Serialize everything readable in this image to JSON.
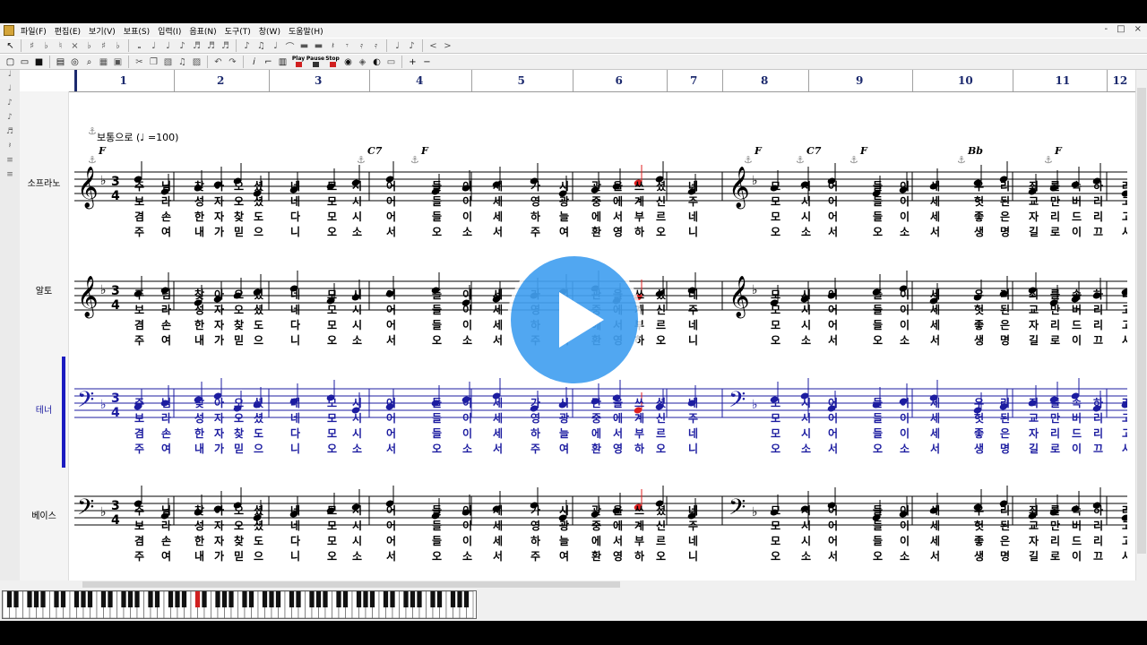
{
  "menu": [
    "파일(F)",
    "편집(E)",
    "보기(V)",
    "보표(S)",
    "입력(I)",
    "음표(N)",
    "도구(T)",
    "창(W)",
    "도움말(H)"
  ],
  "window_controls": [
    "-",
    "□",
    "×"
  ],
  "toolbar2": {
    "play": "Play",
    "pause": "Pause",
    "stop": "Stop"
  },
  "tempo_text": "보통으로 (♩ =100)",
  "measure_numbers": [
    "1",
    "2",
    "3",
    "4",
    "5",
    "6",
    "7",
    "8",
    "9",
    "10",
    "11",
    "12"
  ],
  "parts": [
    {
      "name": "소프라노",
      "clef": "treble",
      "color": "#000000"
    },
    {
      "name": "알토",
      "clef": "treble",
      "color": "#000000"
    },
    {
      "name": "테너",
      "clef": "bass",
      "color": "#1c1ca0"
    },
    {
      "name": "베이스",
      "clef": "bass",
      "color": "#000000"
    }
  ],
  "time_signature": "3/4",
  "key_signature": "F major (1 flat)",
  "chords": [
    {
      "measure": 1,
      "label": "F"
    },
    {
      "measure": 4,
      "label": "C7"
    },
    {
      "measure": 4,
      "label": "F"
    },
    {
      "measure": 8,
      "label": "F"
    },
    {
      "measure": 9,
      "label": "C7"
    },
    {
      "measure": 10,
      "label": "F"
    },
    {
      "measure": 11,
      "label": "Bb"
    },
    {
      "measure": 12,
      "label": "F"
    }
  ],
  "lyrics": [
    [
      "주",
      "님",
      "찾",
      "아",
      "오",
      "셨",
      "네",
      "모",
      "시",
      "어",
      "들",
      "이",
      "세",
      "가",
      "시",
      "관",
      "을",
      "쓰",
      "셨",
      "네",
      "모",
      "시",
      "어",
      "들",
      "이",
      "세",
      "우",
      "리",
      "죄",
      "를",
      "속",
      "하",
      "려"
    ],
    [
      "보",
      "라",
      "성",
      "자",
      "오",
      "셨",
      "네",
      "모",
      "시",
      "어",
      "들",
      "이",
      "세",
      "영",
      "광",
      "중",
      "에",
      "계",
      "신",
      "주",
      "모",
      "시",
      "어",
      "들",
      "이",
      "세",
      "헛",
      "된",
      "교",
      "만",
      "버",
      "리",
      "고"
    ],
    [
      "겸",
      "손",
      "한",
      "자",
      "찾",
      "도",
      "다",
      "모",
      "시",
      "어",
      "들",
      "이",
      "세",
      "하",
      "늘",
      "에",
      "서",
      "부",
      "르",
      "네",
      "모",
      "시",
      "어",
      "들",
      "이",
      "세",
      "좋",
      "은",
      "자",
      "리",
      "드",
      "리",
      "고"
    ],
    [
      "주",
      "여",
      "내",
      "가",
      "믿",
      "으",
      "니",
      "오",
      "소",
      "서",
      "오",
      "소",
      "서",
      "주",
      "여",
      "환",
      "영",
      "하",
      "오",
      "니",
      "오",
      "소",
      "서",
      "오",
      "소",
      "서",
      "생",
      "명",
      "길",
      "로",
      "이",
      "끄",
      "사"
    ]
  ],
  "video_overlay": {
    "icon": "play-icon",
    "color": "#42a0f0"
  }
}
